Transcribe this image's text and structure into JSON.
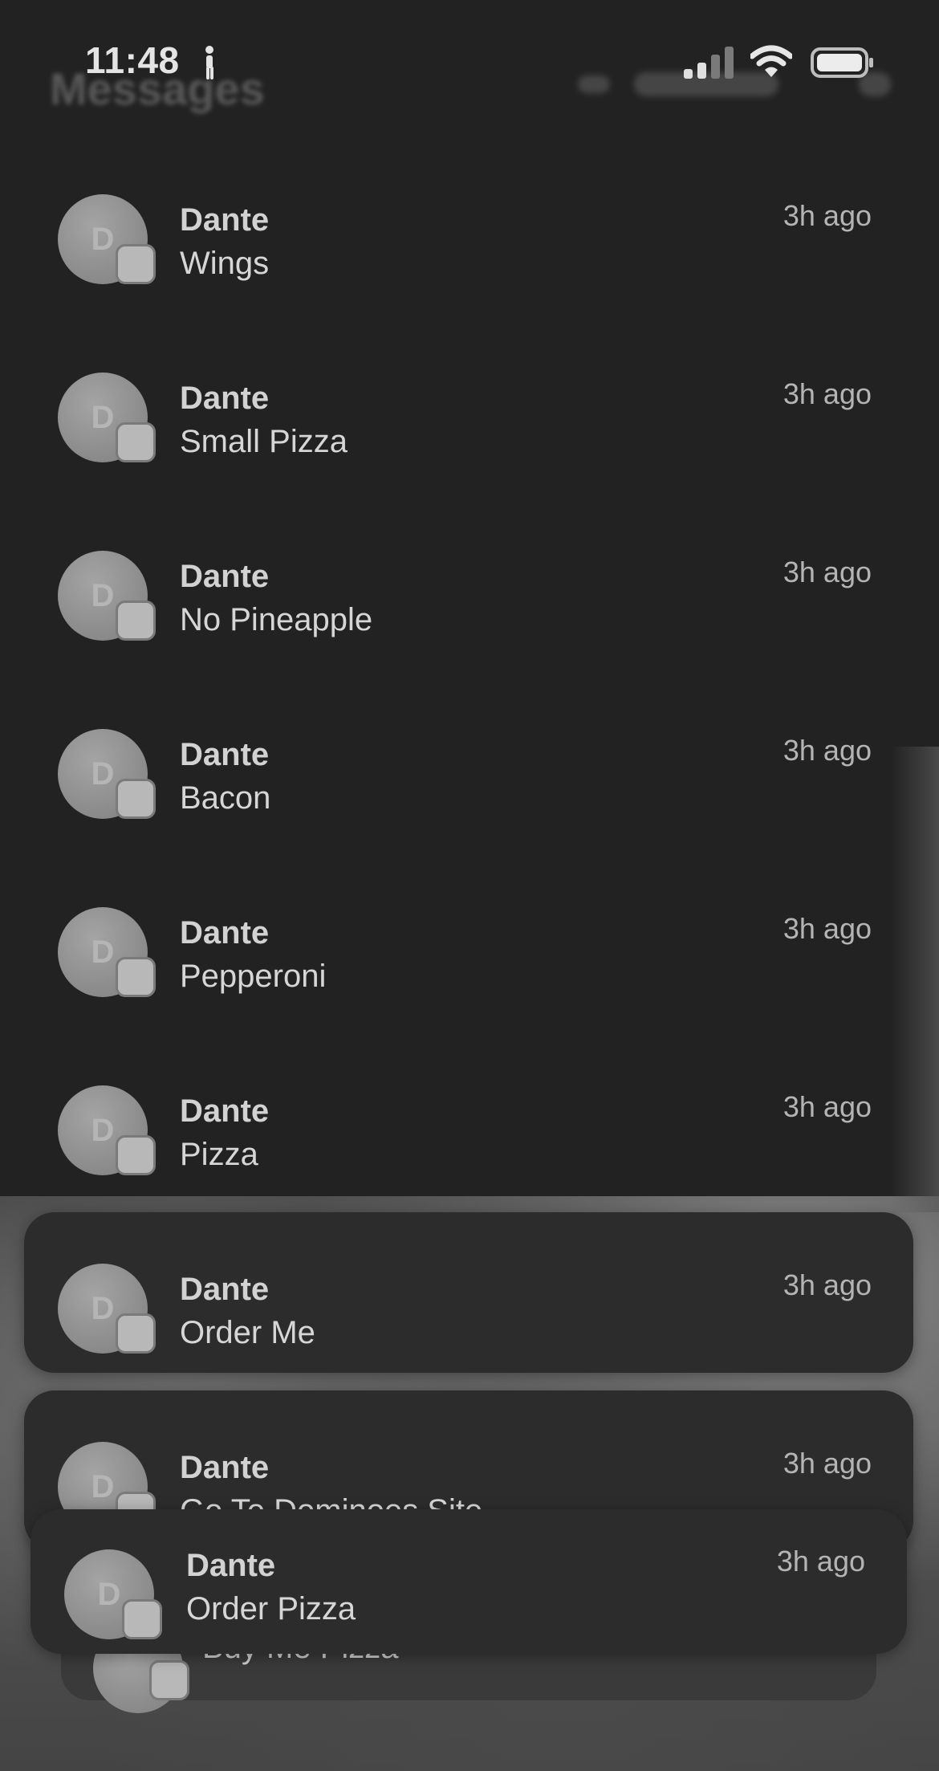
{
  "status_bar": {
    "time": "11:48",
    "ghost_title": "Messages",
    "walk_icon": "person-walking-icon",
    "signal_icon": "cellular-signal-icon",
    "wifi_icon": "wifi-icon",
    "battery_icon": "battery-icon"
  },
  "colors": {
    "background": "#222222",
    "card": "#2c2c2c",
    "text_primary": "#d6d6d6",
    "text_secondary": "#b4b4b4"
  },
  "notifications": [
    {
      "initial": "D",
      "sender": "Dante",
      "message": "Wings",
      "time": "3h ago"
    },
    {
      "initial": "D",
      "sender": "Dante",
      "message": "Small Pizza",
      "time": "3h ago"
    },
    {
      "initial": "D",
      "sender": "Dante",
      "message": "No Pineapple",
      "time": "3h ago"
    },
    {
      "initial": "D",
      "sender": "Dante",
      "message": "Bacon",
      "time": "3h ago"
    },
    {
      "initial": "D",
      "sender": "Dante",
      "message": "Pepperoni",
      "time": "3h ago"
    },
    {
      "initial": "D",
      "sender": "Dante",
      "message": "Pizza",
      "time": "3h ago"
    },
    {
      "initial": "D",
      "sender": "Dante",
      "message": "Order Me",
      "time": "3h ago"
    },
    {
      "initial": "D",
      "sender": "Dante",
      "message": "Go To Dominoes Site",
      "time": "3h ago"
    },
    {
      "initial": "D",
      "sender": "Dante",
      "message": "Order Pizza",
      "time": "3h ago"
    }
  ],
  "stacked_notification": {
    "message": "Buy Me Pizza"
  }
}
